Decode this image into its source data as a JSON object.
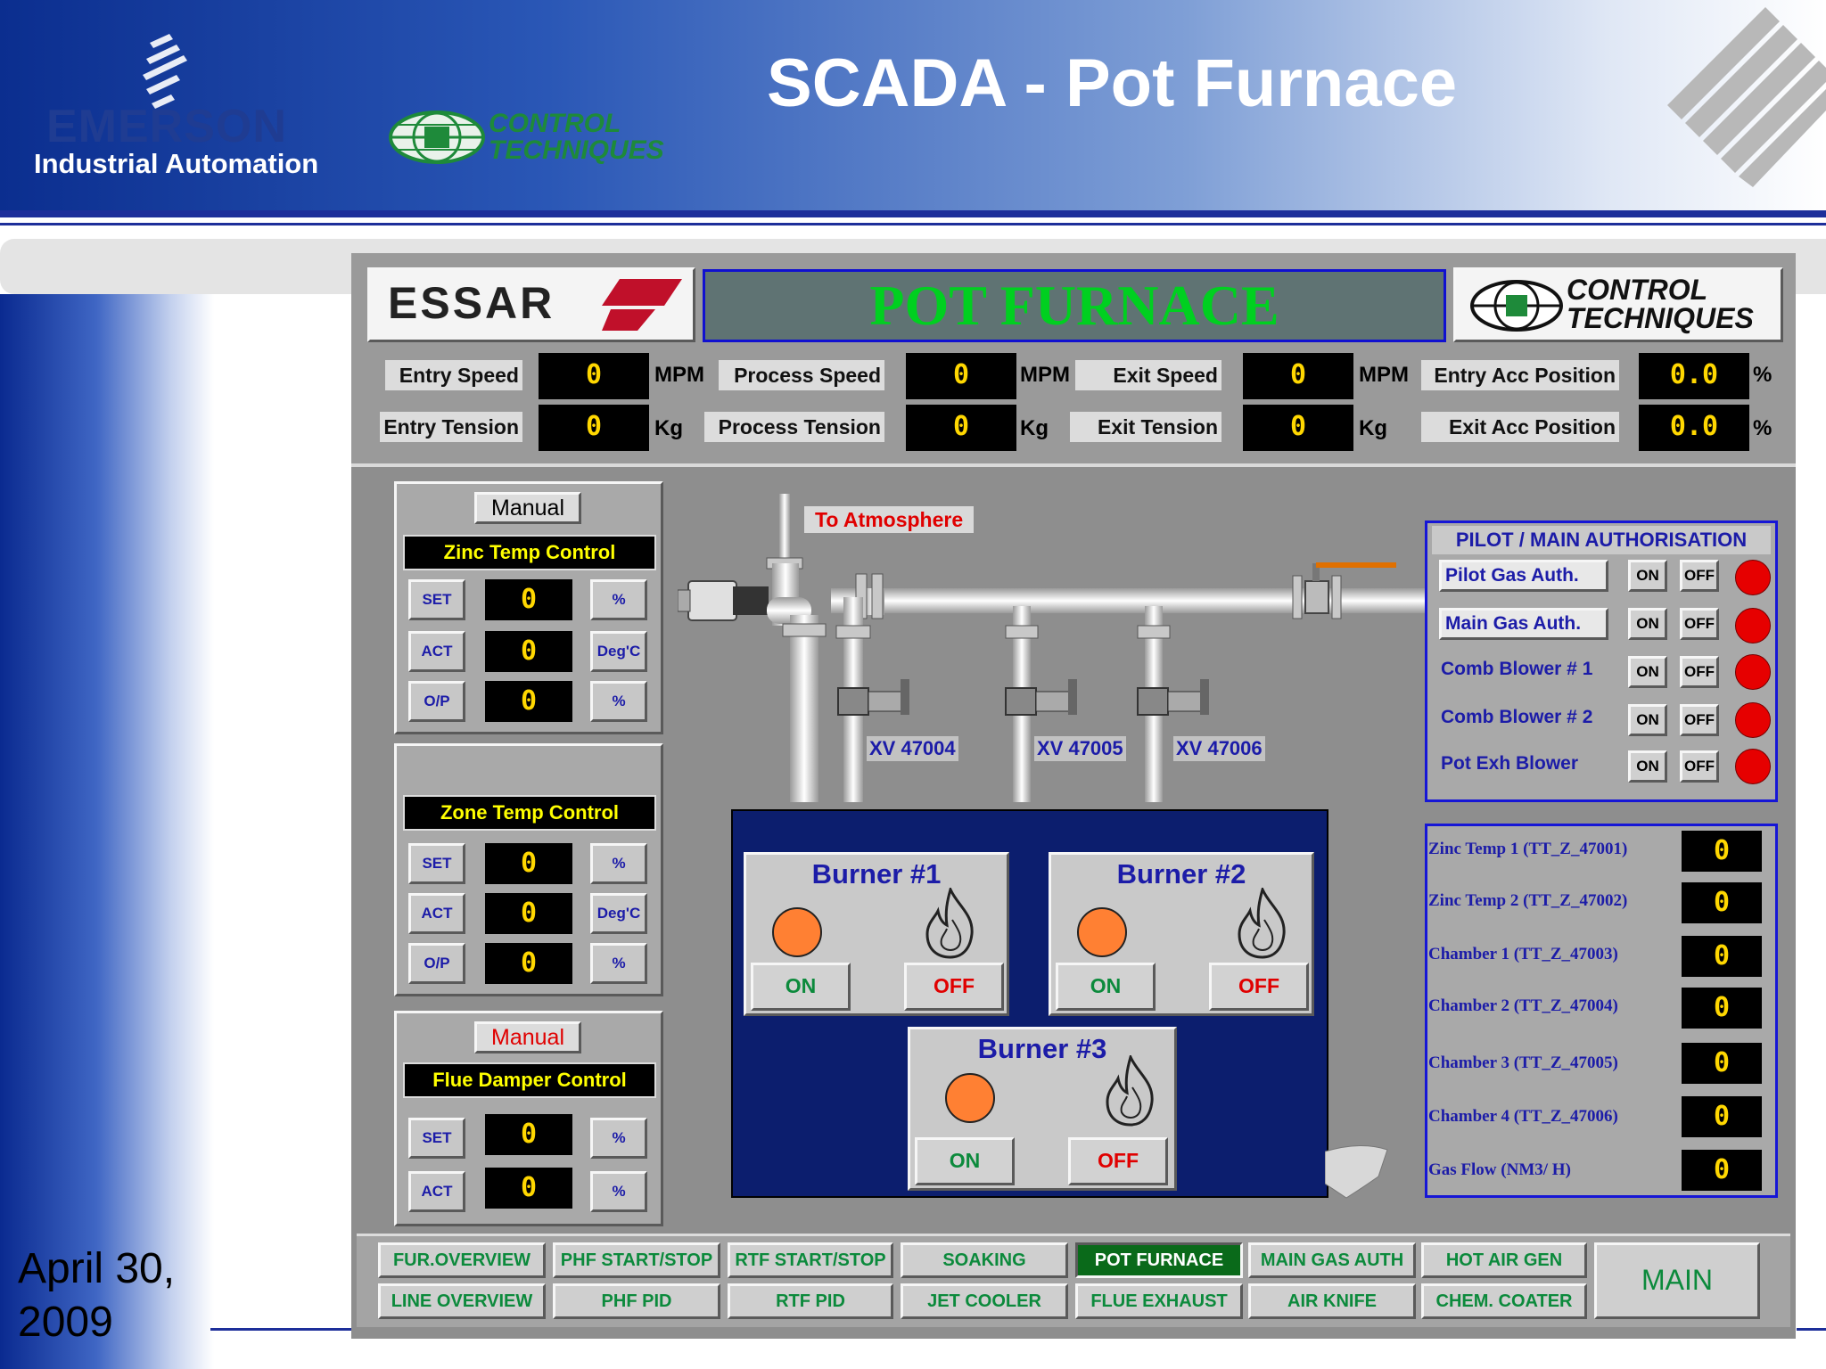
{
  "slide": {
    "title": "SCADA -  Pot Furnace",
    "brand_emerson": "EMERSON",
    "brand_emerson_sub": "Industrial Automation",
    "brand_ct_line1": "CONTROL",
    "brand_ct_line2": "TECHNIQUES",
    "date_line1": "April 30,",
    "date_line2": "2009"
  },
  "scada": {
    "logo_essar": "ESSAR",
    "title": "POT FURNACE",
    "ct_line1": "CONTROL",
    "ct_line2": "TECHNIQUES",
    "readouts": [
      {
        "label": "Entry Speed",
        "value": "0",
        "unit": "MPM"
      },
      {
        "label": "Process Speed",
        "value": "0",
        "unit": "MPM"
      },
      {
        "label": "Exit Speed",
        "value": "0",
        "unit": "MPM"
      },
      {
        "label": "Entry Acc Position",
        "value": "0.0",
        "unit": "%"
      },
      {
        "label": "Entry Tension",
        "value": "0",
        "unit": "Kg"
      },
      {
        "label": "Process Tension",
        "value": "0",
        "unit": "Kg"
      },
      {
        "label": "Exit Tension",
        "value": "0",
        "unit": "Kg"
      },
      {
        "label": "Exit Acc Position",
        "value": "0.0",
        "unit": "%"
      }
    ],
    "zinc_control": {
      "mode": "Manual",
      "title": "Zinc Temp Control",
      "rows": [
        {
          "btn": "SET",
          "value": "0",
          "unit": "%"
        },
        {
          "btn": "ACT",
          "value": "0",
          "unit": "Deg'C"
        },
        {
          "btn": "O/P",
          "value": "0",
          "unit": "%"
        }
      ]
    },
    "zone_control": {
      "title": "Zone Temp Control",
      "rows": [
        {
          "btn": "SET",
          "value": "0",
          "unit": "%"
        },
        {
          "btn": "ACT",
          "value": "0",
          "unit": "Deg'C"
        },
        {
          "btn": "O/P",
          "value": "0",
          "unit": "%"
        }
      ]
    },
    "flue_control": {
      "mode": "Manual",
      "title": "Flue Damper Control",
      "rows": [
        {
          "btn": "SET",
          "value": "0",
          "unit": "%"
        },
        {
          "btn": "ACT",
          "value": "0",
          "unit": "%"
        }
      ]
    },
    "to_atmosphere": "To Atmosphere",
    "valves": [
      "XV 47004",
      "XV 47005",
      "XV 47006"
    ],
    "burners": [
      {
        "name": "Burner #1",
        "on": "ON",
        "off": "OFF"
      },
      {
        "name": "Burner #2",
        "on": "ON",
        "off": "OFF"
      },
      {
        "name": "Burner #3",
        "on": "ON",
        "off": "OFF"
      }
    ],
    "auth": {
      "title": "PILOT / MAIN AUTHORISATION",
      "rows": [
        {
          "label": "Pilot Gas  Auth.",
          "on": "ON",
          "off": "OFF"
        },
        {
          "label": "Main Gas  Auth.",
          "on": "ON",
          "off": "OFF"
        },
        {
          "label": "Comb Blower # 1",
          "on": "ON",
          "off": "OFF"
        },
        {
          "label": "Comb Blower # 2",
          "on": "ON",
          "off": "OFF"
        },
        {
          "label": "Pot Exh Blower",
          "on": "ON",
          "off": "OFF"
        }
      ]
    },
    "sensors": [
      {
        "label": "Zinc Temp 1 (TT_Z_47001)",
        "value": "0"
      },
      {
        "label": "Zinc Temp 2 (TT_Z_47002)",
        "value": "0"
      },
      {
        "label": "Chamber 1 (TT_Z_47003)",
        "value": "0"
      },
      {
        "label": "Chamber 2 (TT_Z_47004)",
        "value": "0"
      },
      {
        "label": "Chamber 3 (TT_Z_47005)",
        "value": "0"
      },
      {
        "label": "Chamber 4 (TT_Z_47006)",
        "value": "0"
      },
      {
        "label": "Gas Flow (NM3/ H)",
        "value": "0"
      }
    ],
    "nav_row1": [
      "FUR.OVERVIEW",
      "PHF START/STOP",
      "RTF START/STOP",
      "SOAKING",
      "POT FURNACE",
      "MAIN GAS AUTH",
      "HOT AIR GEN"
    ],
    "nav_row2": [
      "LINE OVERVIEW",
      "PHF PID",
      "RTF PID",
      "JET COOLER",
      "FLUE EXHAUST",
      "AIR KNIFE",
      "CHEM. COATER"
    ],
    "nav_main": "MAIN"
  },
  "colors": {
    "title_green": "#00d020",
    "label_blue": "#1c1ca8",
    "led_red": "#e60000",
    "lamp_orange": "#ff8033",
    "active_nav_bg": "#0a6a1a"
  }
}
